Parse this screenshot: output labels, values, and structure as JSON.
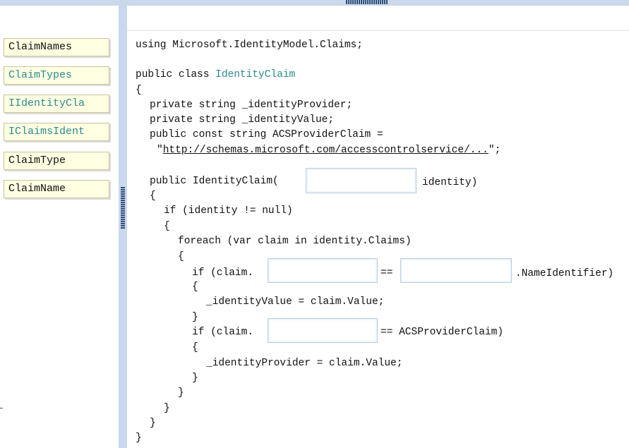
{
  "palette": {
    "type_color": "#2b8a91",
    "chip_bg": "#ffffe2",
    "splitter": "#c9d8ea"
  },
  "answer_choices": [
    "ClaimNames",
    "ClaimTypes",
    "IIdentityCla",
    "IClaimsIdent",
    "ClaimType",
    "ClaimName"
  ],
  "code": {
    "l1": "using Microsoft.IdentityModel.Claims;",
    "l2a": "public class ",
    "l2b": "IdentityClaim",
    "l3": "{",
    "l4": "private string _identityProvider;",
    "l5": "private string _identityValue;",
    "l6": "public const string ACSProviderClaim =",
    "l7q1": "\"",
    "l7url": "http://schemas.microsoft.com/accesscontrolservice/...",
    "l7q2": "\";",
    "l8a": "public IdentityClaim(",
    "l8b": "identity)",
    "l9": "{",
    "l10": "if (identity != null)",
    "l11": "{",
    "l12": "foreach (var claim in identity.Claims)",
    "l13": "{",
    "l14a": "if (claim.",
    "l14b": "==",
    "l14c": ".NameIdentifier)",
    "l15": "{",
    "l16": "_identityValue = claim.Value;",
    "l17": "}",
    "l18a": "if (claim.",
    "l18b": "== ACSProviderClaim)",
    "l19": "{",
    "l20": "_identityProvider = claim.Value;",
    "l21": "}",
    "l22": "}",
    "l23": "}",
    "l24": "}",
    "l25": "}"
  }
}
